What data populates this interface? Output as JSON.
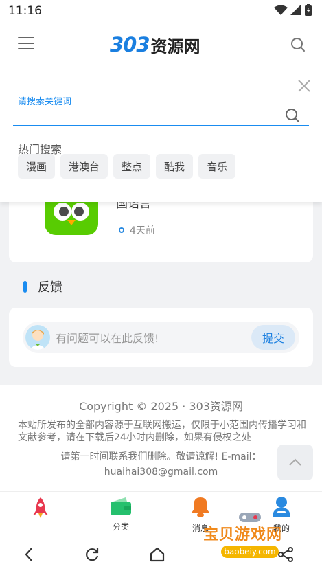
{
  "status": {
    "time": "11:16"
  },
  "header": {
    "logo_number": "303",
    "logo_text": "资源网"
  },
  "search_panel": {
    "label": "请搜索关键词",
    "input_value": "",
    "hot_title": "热门搜索",
    "hot_tags": [
      "漫画",
      "港澳台",
      "整点",
      "酷我",
      "音乐"
    ]
  },
  "content_card": {
    "title": "国语言",
    "time": "4天前"
  },
  "feedback": {
    "heading": "反馈",
    "placeholder": "有问题可以在此反馈!",
    "submit_label": "提交"
  },
  "footer": {
    "copyright": "Copyright ©  2025 · 303资源网",
    "disclaimer": "本站所发布的全部内容源于互联网搬运，仅限于小范围内传播学习和文献参考，请在下载后24小时内删除，如果有侵权之处",
    "contact_line": "请第一时间联系我们删除。敬请谅解! E-mail：",
    "email": "huaihai308@gmail.com"
  },
  "tabs": [
    {
      "label": "",
      "icon": "rocket-icon"
    },
    {
      "label": "分类",
      "icon": "wallet-icon"
    },
    {
      "label": "消息",
      "icon": "bell-icon"
    },
    {
      "label": "我的",
      "icon": "user-icon"
    }
  ],
  "watermark": {
    "text": "宝贝游戏网",
    "url": "baobeiy.com"
  },
  "colors": {
    "accent": "#1a8cf0",
    "logo_blue": "#1a7fe0",
    "bell": "#f07a22",
    "rocket": "#e8384f",
    "wallet": "#25c06d"
  }
}
